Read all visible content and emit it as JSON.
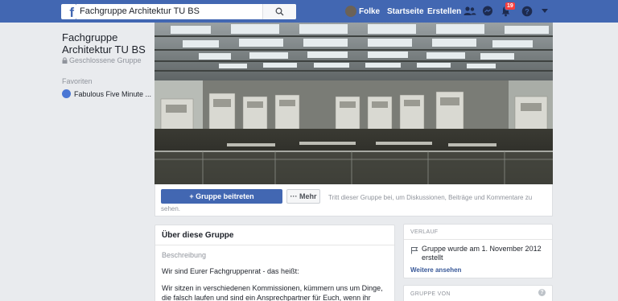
{
  "topbar": {
    "search_value": "Fachgruppe Architektur TU BS",
    "user_name": "Folke",
    "nav_home": "Startseite",
    "nav_create": "Erstellen",
    "notifications_count": "19"
  },
  "sidebar": {
    "group_name": "Fachgruppe Architektur TU BS",
    "group_type": "Geschlossene Gruppe",
    "favorites_heading": "Favoriten",
    "favorites": [
      {
        "label": "Fabulous Five Minute ..."
      }
    ]
  },
  "actions": {
    "join_label": "+ Gruppe beitreten",
    "more_label": "··· Mehr",
    "join_hint": "Tritt dieser Gruppe bei, um Diskussionen, Beiträge und Kommentare zu sehen."
  },
  "about": {
    "title": "Über diese Gruppe",
    "subtitle": "Beschreibung",
    "para1": "Wir sind Eurer Fachgruppenrat - das heißt:",
    "para2": "Wir sitzen in verschiedenen Kommissionen, kümmern uns um Dinge, die falsch laufen und sind ein Ansprechpartner für Euch, wenn ihr Probleme,"
  },
  "history": {
    "heading": "VERLAUF",
    "item": "Gruppe wurde am 1. November 2012 erstellt",
    "more_link": "Weitere ansehen"
  },
  "group_by": {
    "heading": "GRUPPE VON"
  },
  "colors": {
    "brand_blue": "#4267b2",
    "link_blue": "#385898",
    "badge_red": "#fa3e3e",
    "page_bg": "#e9ebee"
  },
  "icons": [
    "facebook-logo-icon",
    "search-icon",
    "lock-icon",
    "group-icon",
    "friends-icon",
    "messenger-icon",
    "bell-icon",
    "help-icon",
    "caret-down-icon",
    "flag-icon"
  ]
}
